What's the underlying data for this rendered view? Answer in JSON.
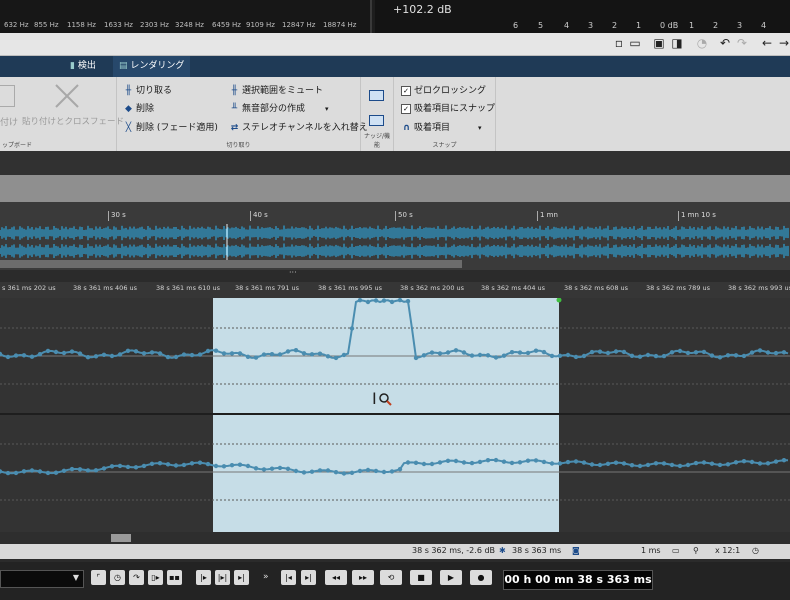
{
  "analyzer": {
    "freqs": [
      "632 Hz",
      "855 Hz",
      "1158 Hz",
      "1633 Hz",
      "2303 Hz",
      "3248 Hz",
      "6459 Hz",
      "9109 Hz",
      "12847 Hz",
      "18874 Hz"
    ],
    "db_readout": "+102.2 dB",
    "db_ticks": [
      "6",
      "5",
      "4",
      "3",
      "2",
      "1",
      "0 dB",
      "1",
      "2",
      "3",
      "4"
    ]
  },
  "ribbon_tabs": [
    "検出",
    "レンダリング"
  ],
  "clipboard": {
    "paste_label": "付け",
    "crossfade_label": "貼り付けとクロスフェード",
    "group_title": "ップボード"
  },
  "cut_group": {
    "items": [
      "切り取る",
      "削除",
      "削除 (フェード適用)",
      "選択範囲をミュート",
      "無音部分の作成",
      "ステレオチャンネルを入れ替え"
    ],
    "group_title": "切り取り"
  },
  "snap_edit": {
    "group_title": "ナッジ/機能"
  },
  "snap": {
    "items": [
      "ゼロクロッシング",
      "吸着項目にスナップ",
      "吸着項目"
    ],
    "zero_crossing_checked": true,
    "snap_items_checked": true,
    "group_title": "スナップ"
  },
  "overview_ruler": [
    "30 s",
    "40 s",
    "50 s",
    "1 mn",
    "1 mn 10 s"
  ],
  "main_ruler": [
    "s 361 ms 202 us",
    "38 s 361 ms 406 us",
    "38 s 361 ms 610 us",
    "38 s 361 ms 791 us",
    "38 s 361 ms 995 us",
    "38 s 362 ms 200 us",
    "38 s 362 ms 404 us",
    "38 s 362 ms 608 us",
    "38 s 362 ms 789 us",
    "38 s 362 ms 993 us"
  ],
  "status": {
    "cursor_info": "38 s 362 ms, -2.6 dB",
    "position": "38 s 363 ms",
    "duration": "1 ms",
    "zoom": "x 12:1"
  },
  "transport": {
    "time_display": "00 h 00 mn 38 s 363 ms"
  },
  "colors": {
    "accent": "#2ea2d6",
    "selection": "#c6dde7",
    "wave": "#4a8db0"
  }
}
